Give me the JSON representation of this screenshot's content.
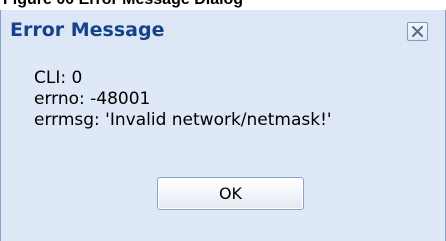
{
  "caption": {
    "partial_text": "Figure 00 Error Message Dialog"
  },
  "dialog": {
    "title": "Error Message",
    "close_icon": "close-x-icon",
    "lines": [
      "CLI: 0",
      "errno: -48001",
      "errmsg: 'Invalid network/netmask!'"
    ],
    "ok_label": "OK",
    "colors": {
      "title": "#15428b",
      "body_background": "#dfe8f6",
      "border": "#8aa3c9"
    }
  }
}
